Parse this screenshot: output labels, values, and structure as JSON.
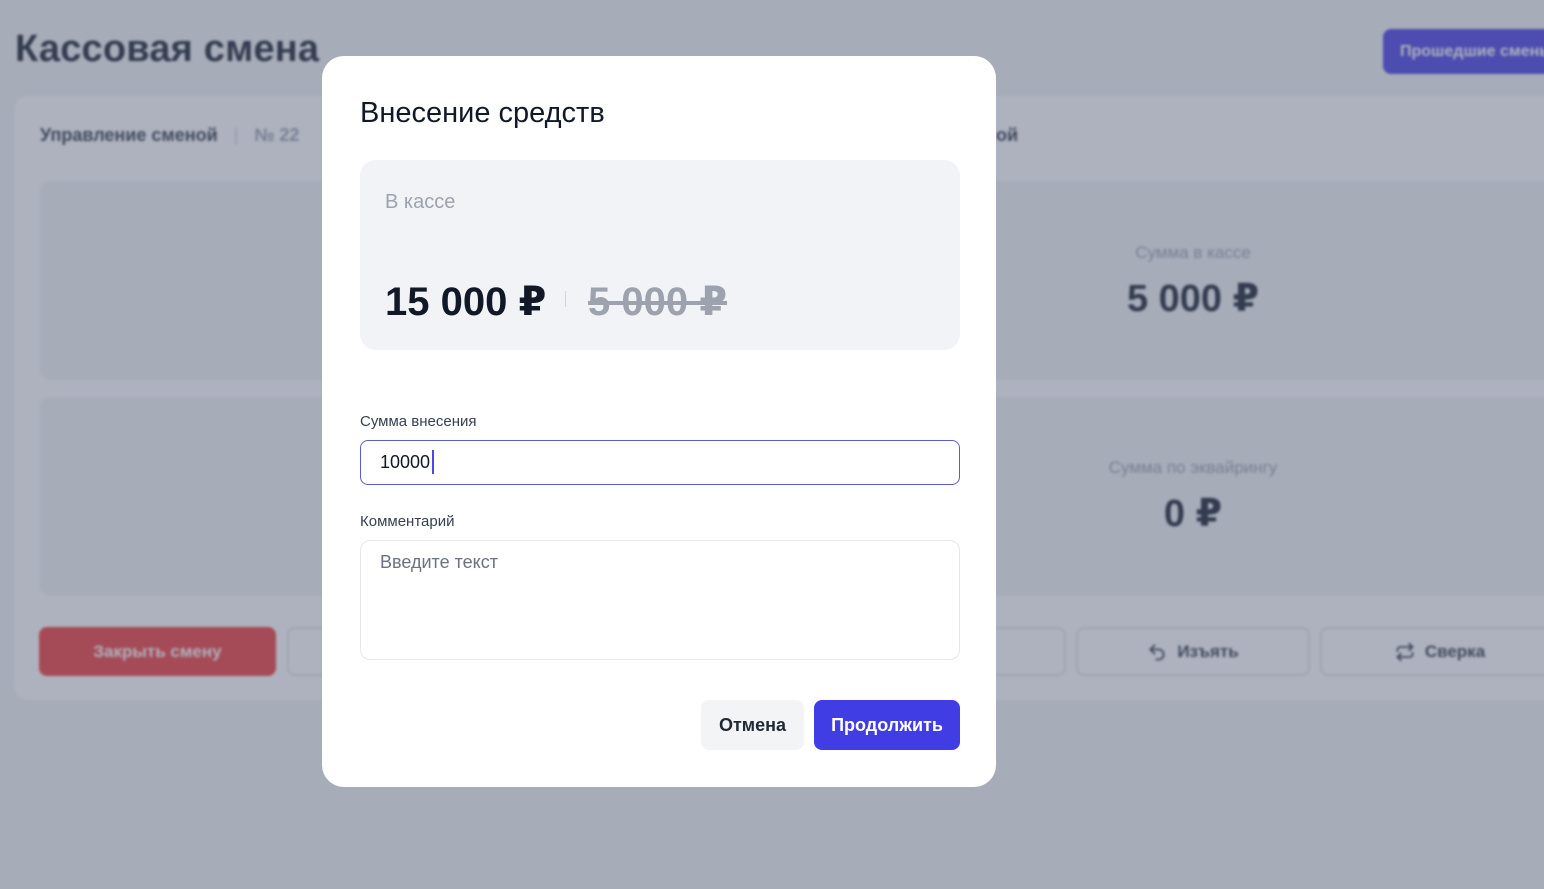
{
  "page": {
    "title": "Кассовая смена",
    "history_button": "Прошедшие смены"
  },
  "card": {
    "header_label": "Управление сменой",
    "shift_number": "№ 22",
    "header_right": "ой"
  },
  "metrics": [
    {
      "label": "Сумма в кассе",
      "value": "5 000 ₽"
    },
    {
      "label": "Сумма по эквайрингу",
      "value": "0 ₽"
    }
  ],
  "actions": {
    "close_shift": "Закрыть смену",
    "withdraw": "Изъять",
    "reconcile": "Сверка"
  },
  "modal": {
    "title": "Внесение средств",
    "cash_label": "В кассе",
    "cash_new": "15 000 ₽",
    "cash_old": "5 000 ₽",
    "amount_label": "Сумма внесения",
    "amount_value": "10000",
    "comment_label": "Комментарий",
    "comment_placeholder": "Введите текст",
    "cancel_label": "Отмена",
    "continue_label": "Продолжить"
  },
  "colors": {
    "accent": "#3f3de3",
    "danger": "#ef4444",
    "overlay": "#4b556e"
  }
}
